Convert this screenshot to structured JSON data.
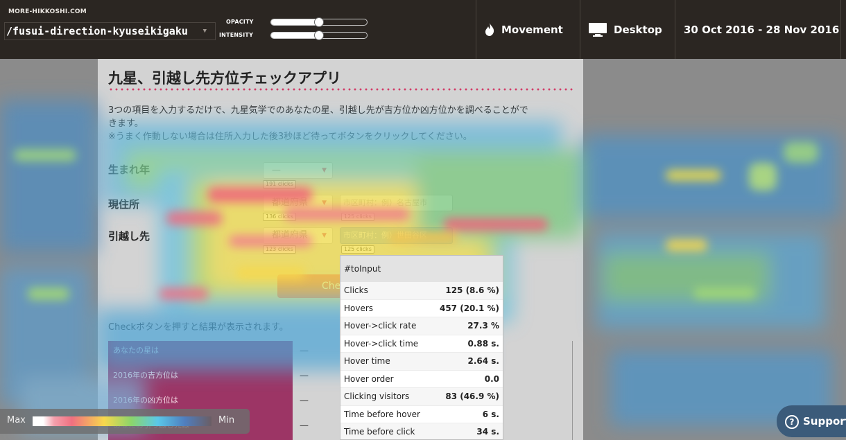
{
  "toolbar": {
    "site": "MORE-HIKKOSHI.COM",
    "page": "/fusui-direction-kyuseikigaku",
    "opacity_label": "OPACITY",
    "intensity_label": "INTENSITY",
    "opacity_value": 0.5,
    "intensity_value": 0.5,
    "movement_label": "Movement",
    "device_label": "Desktop",
    "date_range": "30 Oct 2016 - 28 Nov 2016"
  },
  "page": {
    "title": "九星、引越し先方位チェックアプリ",
    "desc_line1": "3つの項目を入力するだけで、九星気学でのあなたの星、引越し先が吉方位か凶方位かを調べることがで",
    "desc_line2": "きます。",
    "desc_line3": "※うまく作動しない場合は住所入力した後3秒ほど待ってボタンをクリックしてください。",
    "birth_label": "生まれ年",
    "birth_value": "—",
    "birth_clicks": "191 clicks",
    "current_label": "現住所",
    "pref_placeholder": "都道府県",
    "current_pref_clicks": "136 clicks",
    "current_city_placeholder": "市区町村：例）名古屋市",
    "current_city_clicks": "125 clicks",
    "dest_label": "引越し先",
    "dest_pref_clicks": "123 clicks",
    "dest_city_placeholder": "市区町村：例）世田谷区",
    "dest_city_clicks": "125 clicks",
    "check_button": "Che",
    "note": "Checkボタンを押すと結果が表示されます。",
    "results": [
      {
        "label": "あなたの星は",
        "value": "—"
      },
      {
        "label": "2016年の吉方位は",
        "value": "—"
      },
      {
        "label": "2016年の凶方位は",
        "value": "—"
      },
      {
        "label": "あなたの引っ越し先は",
        "value": "—"
      }
    ]
  },
  "tooltip": {
    "selector": "#toInput",
    "rows": [
      {
        "label": "Clicks",
        "value": "125 (8.6 %)"
      },
      {
        "label": "Hovers",
        "value": "457 (20.1 %)"
      },
      {
        "label": "Hover->click rate",
        "value": "27.3 %"
      },
      {
        "label": "Hover->click time",
        "value": "0.88 s."
      },
      {
        "label": "Hover time",
        "value": "2.64 s."
      },
      {
        "label": "Hover order",
        "value": "0.0"
      },
      {
        "label": "Clicking visitors",
        "value": "83 (46.9 %)"
      },
      {
        "label": "Time before hover",
        "value": "6 s."
      },
      {
        "label": "Time before click",
        "value": "34 s."
      }
    ]
  },
  "legend": {
    "max": "Max",
    "min": "Min"
  },
  "support": "Support",
  "colors": {
    "toolbar": "#2b2622",
    "accent": "#d23d68",
    "support": "#3b5b7a"
  }
}
